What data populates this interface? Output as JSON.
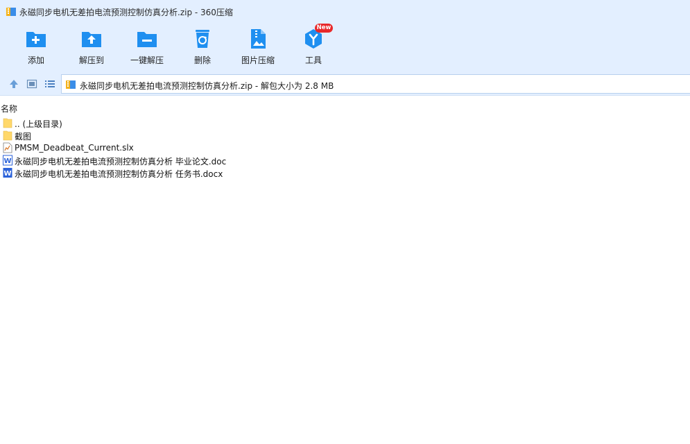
{
  "window": {
    "title": "永磁同步电机无差拍电流预测控制仿真分析.zip - 360压缩"
  },
  "toolbar": {
    "items": [
      {
        "label": "添加",
        "icon": "add-folder-icon"
      },
      {
        "label": "解压到",
        "icon": "extract-to-folder-icon"
      },
      {
        "label": "一键解压",
        "icon": "one-click-extract-icon"
      },
      {
        "label": "删除",
        "icon": "recycle-bin-icon"
      },
      {
        "label": "图片压缩",
        "icon": "image-compress-icon"
      },
      {
        "label": "工具",
        "icon": "tools-cube-icon",
        "badge": "New"
      }
    ]
  },
  "nav": {
    "address": "永磁同步电机无差拍电流预测控制仿真分析.zip - 解包大小为 2.8 MB"
  },
  "list": {
    "columns": {
      "name": "名称"
    },
    "rows": [
      {
        "name": ".. (上级目录)",
        "type": "folder"
      },
      {
        "name": "截图",
        "type": "folder"
      },
      {
        "name": "PMSM_Deadbeat_Current.slx",
        "type": "file"
      },
      {
        "name": "永磁同步电机无差拍电流预测控制仿真分析 毕业论文.doc",
        "type": "word"
      },
      {
        "name": "永磁同步电机无差拍电流预测控制仿真分析 任务书.docx",
        "type": "word"
      }
    ]
  },
  "colors": {
    "toolbar_bg": "#e3efff",
    "icon_blue": "#1f8ff0",
    "badge_red": "#e8292b",
    "folder_yellow": "#ffd86b",
    "word_blue": "#2b62d9"
  }
}
